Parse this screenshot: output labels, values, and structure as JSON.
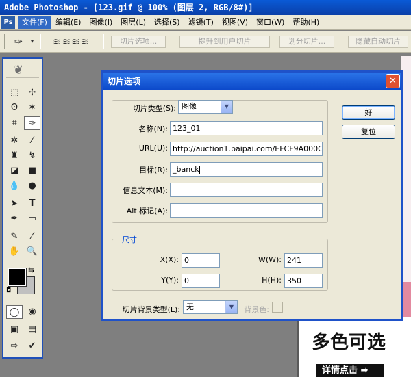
{
  "app": {
    "window_title": "Adobe Photoshop - [123.gif @ 100% (图层 2, RGB/8#)]",
    "logo_text": "Ps"
  },
  "menu": {
    "items": [
      {
        "label": "文件(F)",
        "active": true
      },
      {
        "label": "编辑(E)"
      },
      {
        "label": "图像(I)"
      },
      {
        "label": "图层(L)"
      },
      {
        "label": "选择(S)"
      },
      {
        "label": "滤镜(T)"
      },
      {
        "label": "视图(V)"
      },
      {
        "label": "窗口(W)"
      },
      {
        "label": "帮助(H)"
      }
    ]
  },
  "options_bar": {
    "slice_options": "切片选项...",
    "promote": "提升到用户切片",
    "divide": "划分切片...",
    "hide_auto": "隐藏自动切片"
  },
  "canvas": {
    "headline": "多色可选",
    "button_text": "详情点击 ➡"
  },
  "dialog": {
    "title": "切片选项",
    "close": "✕",
    "slice_type_label": "切片类型(S):",
    "slice_type_value": "图像",
    "name_label": "名称(N):",
    "name_value": "123_01",
    "url_label": "URL(U):",
    "url_value": "http://auction1.paipai.com/EFCF9A000C",
    "target_label": "目标(R):",
    "target_value": "_banck",
    "message_label": "信息文本(M):",
    "message_value": "",
    "alt_label": "Alt 标记(A):",
    "alt_value": "",
    "size_legend": "尺寸",
    "x_label": "X(X):",
    "x_value": "0",
    "y_label": "Y(Y):",
    "y_value": "0",
    "w_label": "W(W):",
    "w_value": "241",
    "h_label": "H(H):",
    "h_value": "350",
    "bg_type_label": "切片背景类型(L):",
    "bg_type_value": "无",
    "bg_color_label": "背景色:",
    "ok": "好",
    "reset": "复位"
  }
}
